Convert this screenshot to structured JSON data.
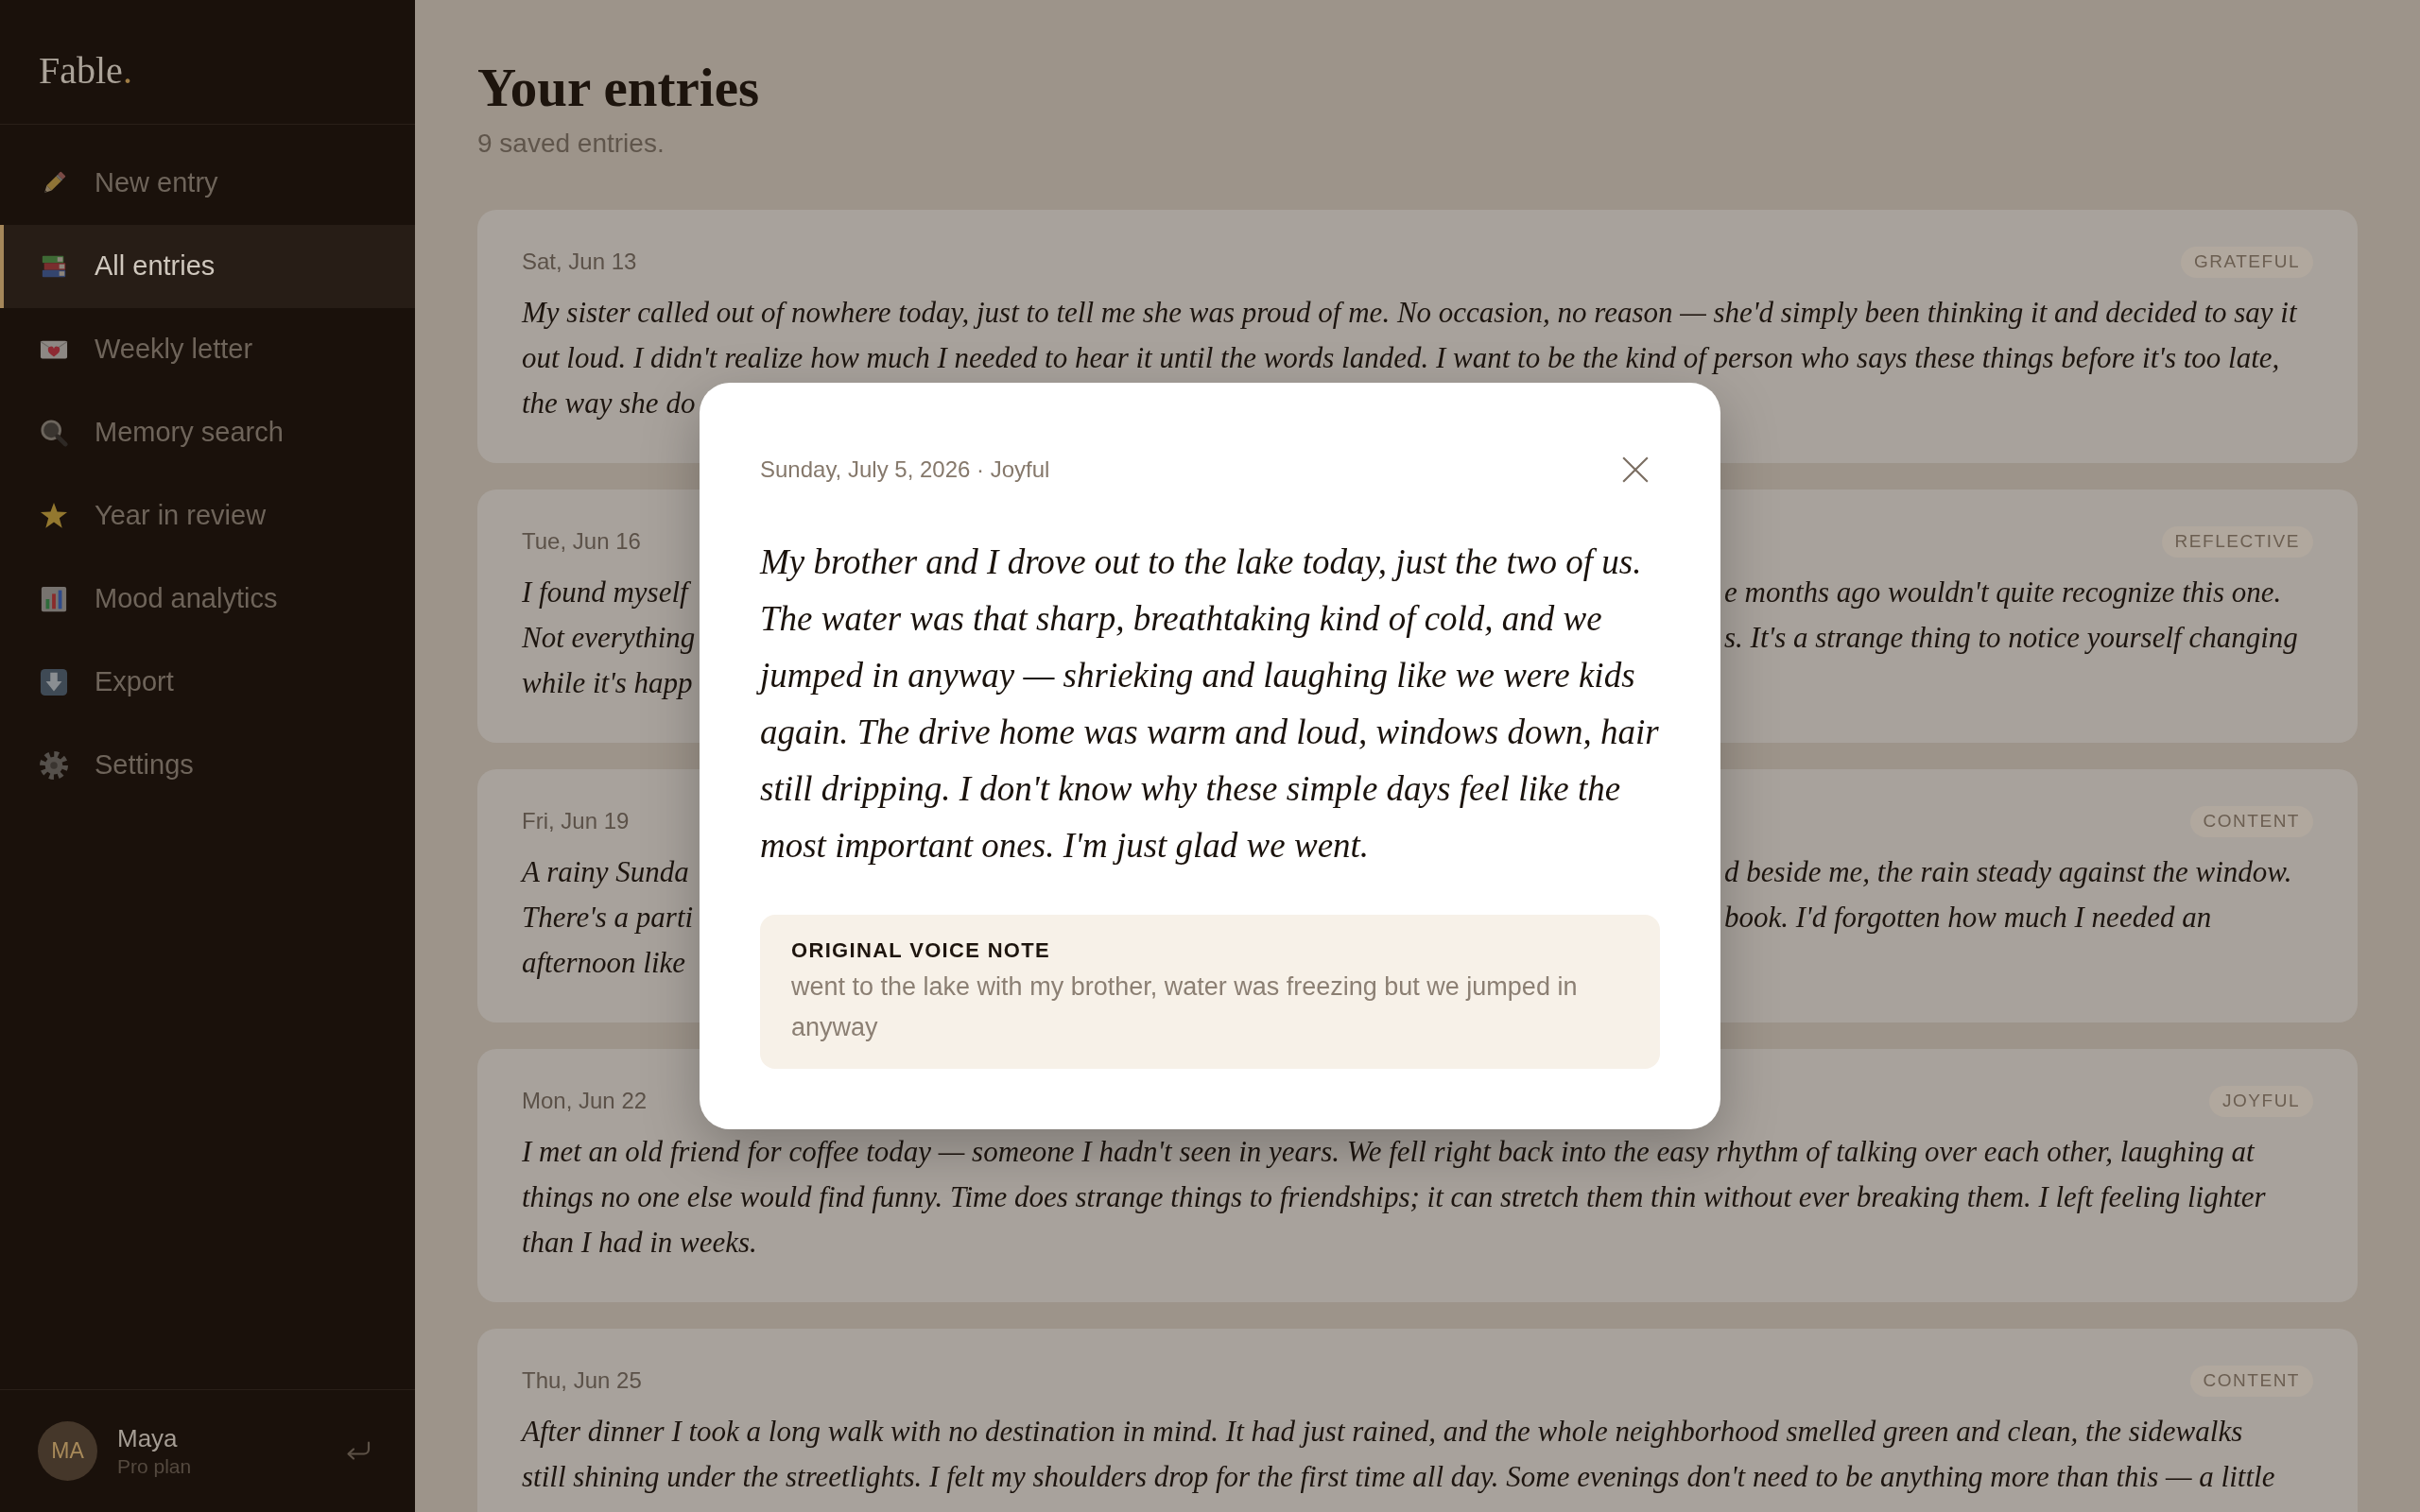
{
  "sidebar": {
    "logo": {
      "text": "Fable",
      "accent": "."
    },
    "nav": [
      {
        "label": "New entry",
        "selected": false
      },
      {
        "label": "All entries",
        "selected": true
      },
      {
        "label": "Weekly letter",
        "selected": false
      },
      {
        "label": "Memory search",
        "selected": false
      },
      {
        "label": "Year in review",
        "selected": false
      },
      {
        "label": "Mood analytics",
        "selected": false
      },
      {
        "label": "Export",
        "selected": false
      },
      {
        "label": "Settings",
        "selected": false
      }
    ],
    "user": {
      "initials": "MA",
      "name": "Maya",
      "plan": "Pro plan"
    }
  },
  "main": {
    "title": "Your entries",
    "subtitle": "9 saved entries.",
    "entries": [
      {
        "date": "Sat, Jun 13",
        "mood": "GRATEFUL",
        "lines": [
          [
            "My sister called out of nowhere today, just to tell me she was proud of me. No occasion, no reason — she'd simply been thinking it and decided to say it"
          ],
          [
            "out loud. I didn't realize how much I needed to hear it until the words landed. I want to be the kind of person who says these things before it's too late,"
          ],
          [
            "the way she do"
          ]
        ]
      },
      {
        "date": "Tue, Jun 16",
        "mood": "REFLECTIVE",
        "lines": [
          [
            "I found myself",
            "e months ago wouldn't quite recognize this one."
          ],
          [
            "Not everything",
            "s. It's a strange thing to notice yourself changing"
          ],
          [
            "while it's happ"
          ]
        ]
      },
      {
        "date": "Fri, Jun 19",
        "mood": "CONTENT",
        "lines": [
          [
            "A rainy Sunda",
            "d beside me, the rain steady against the window."
          ],
          [
            "There's a parti",
            "book. I'd forgotten how much I needed an"
          ],
          [
            "afternoon like"
          ]
        ]
      },
      {
        "date": "Mon, Jun 22",
        "mood": "JOYFUL",
        "lines": [
          [
            "I met an old friend for coffee today — someone I hadn't seen in years. We fell right back into the easy rhythm of talking over each other, laughing at"
          ],
          [
            "things no one else would find funny. Time does strange things to friendships; it can stretch them thin without ever breaking them. I left feeling lighter"
          ],
          [
            "than I had in weeks."
          ]
        ]
      },
      {
        "date": "Thu, Jun 25",
        "mood": "CONTENT",
        "lines": [
          [
            "After dinner I took a long walk with no destination in mind. It had just rained, and the whole neighborhood smelled green and clean, the sidewalks"
          ],
          [
            "still shining under the streetlights. I felt my shoulders drop for the first time all day. Some evenings don't need to be anything more than this — a little"
          ]
        ]
      }
    ]
  },
  "modal": {
    "meta": "Sunday, July 5, 2026 · Joyful",
    "text": "My brother and I drove out to the lake today, just the two of us. The water was that sharp, breathtaking kind of cold, and we jumped in anyway — shrieking and laughing like we were kids again. The drive home was warm and loud, windows down, hair still dripping. I don't know why these simple days feel like the most important ones. I'm just glad we went.",
    "voice_note": {
      "label": "ORIGINAL VOICE NOTE",
      "text": "went to the lake with my brother, water was freezing but we jumped in anyway"
    }
  }
}
